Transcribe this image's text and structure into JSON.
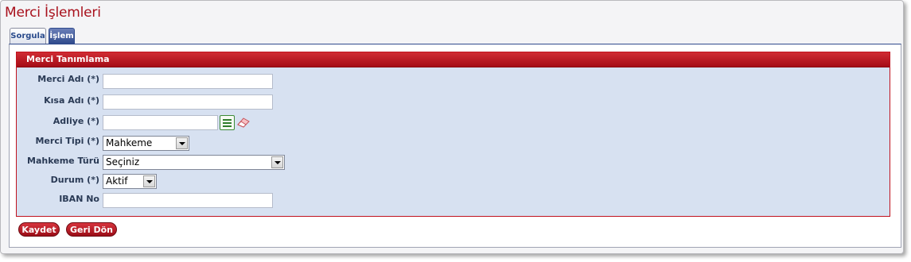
{
  "page": {
    "title": "Merci İşlemleri"
  },
  "tabs": [
    {
      "label": "Sorgula"
    },
    {
      "label": "İşlem"
    }
  ],
  "form": {
    "header": "Merci Tanımlama",
    "fields": {
      "merci_adi": {
        "label": "Merci Adı (*)",
        "value": ""
      },
      "kisa_adi": {
        "label": "Kısa Adı (*)",
        "value": ""
      },
      "adliye": {
        "label": "Adliye (*)",
        "value": ""
      },
      "merci_tipi": {
        "label": "Merci Tipi (*)",
        "value": "Mahkeme"
      },
      "mahkeme_turu": {
        "label": "Mahkeme Türü",
        "value": "Seçiniz"
      },
      "durum": {
        "label": "Durum (*)",
        "value": "Aktif"
      },
      "iban_no": {
        "label": "IBAN No",
        "value": ""
      }
    }
  },
  "buttons": {
    "save": "Kaydet",
    "back": "Geri Dön"
  },
  "icons": {
    "adliye_lookup": "list-lookup-icon",
    "adliye_clear": "eraser-icon"
  },
  "colors": {
    "title": "#a8101c",
    "form_header": "#c0121e",
    "form_bg": "#d7e1f1",
    "active_tab": "#2f4a8c"
  }
}
